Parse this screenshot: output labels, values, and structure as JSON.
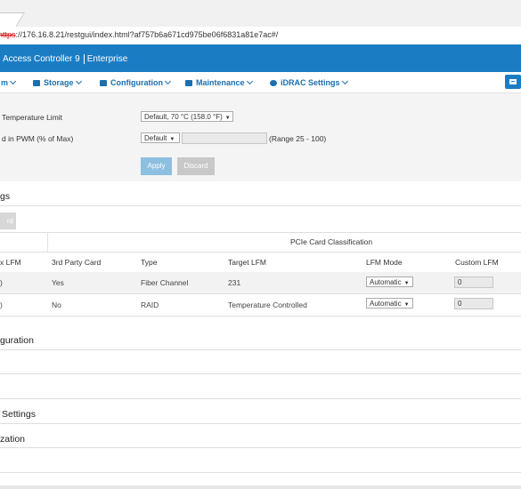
{
  "browser": {
    "url_scheme": "https",
    "url_rest": "://176.16.8.21/restgui/index.html?af757b6a671cd975be06f6831a81e7ac#/"
  },
  "header": {
    "title": "Access Controller 9",
    "edition": "Enterprise",
    "colors": {
      "brand": "#1a7dc4"
    }
  },
  "nav": {
    "items": [
      {
        "label": "m",
        "icon": ""
      },
      {
        "label": "Storage",
        "icon": "storage-icon"
      },
      {
        "label": "Configuration",
        "icon": "configuration-icon"
      },
      {
        "label": "Maintenance",
        "icon": "maintenance-icon"
      },
      {
        "label": "iDRAC Settings",
        "icon": "idrac-settings-icon"
      }
    ],
    "right_icon": "menu-icon"
  },
  "thermal": {
    "temp_limit_label": "Temperature Limit",
    "temp_limit_value": "Default, 70 °C (158.0 °F)",
    "pwm_label": "d in PWM (% of Max)",
    "pwm_select_value": "Default",
    "pwm_input_value": "",
    "pwm_range": "(Range 25 - 100)",
    "apply_label": "Apply",
    "discard_label": "Discard"
  },
  "pcie": {
    "section_title": "gs",
    "reset_label": "rd",
    "group_header": "PCIe Card Classification",
    "columns": [
      "x LFM",
      "3rd Party Card",
      "Type",
      "Target LFM",
      "LFM Mode",
      "Custom LFM"
    ],
    "rows": [
      {
        "lfm": ")",
        "third_party": "Yes",
        "type": "Fiber Channel",
        "target_lfm": "231",
        "mode": "Automatic",
        "custom": "0"
      },
      {
        "lfm": ")",
        "third_party": "No",
        "type": "RAID",
        "target_lfm": "Temperature Controlled",
        "mode": "Automatic",
        "custom": "0"
      }
    ]
  },
  "sections": {
    "configuration": "guration",
    "settings": "Settings",
    "zation": "zation"
  }
}
